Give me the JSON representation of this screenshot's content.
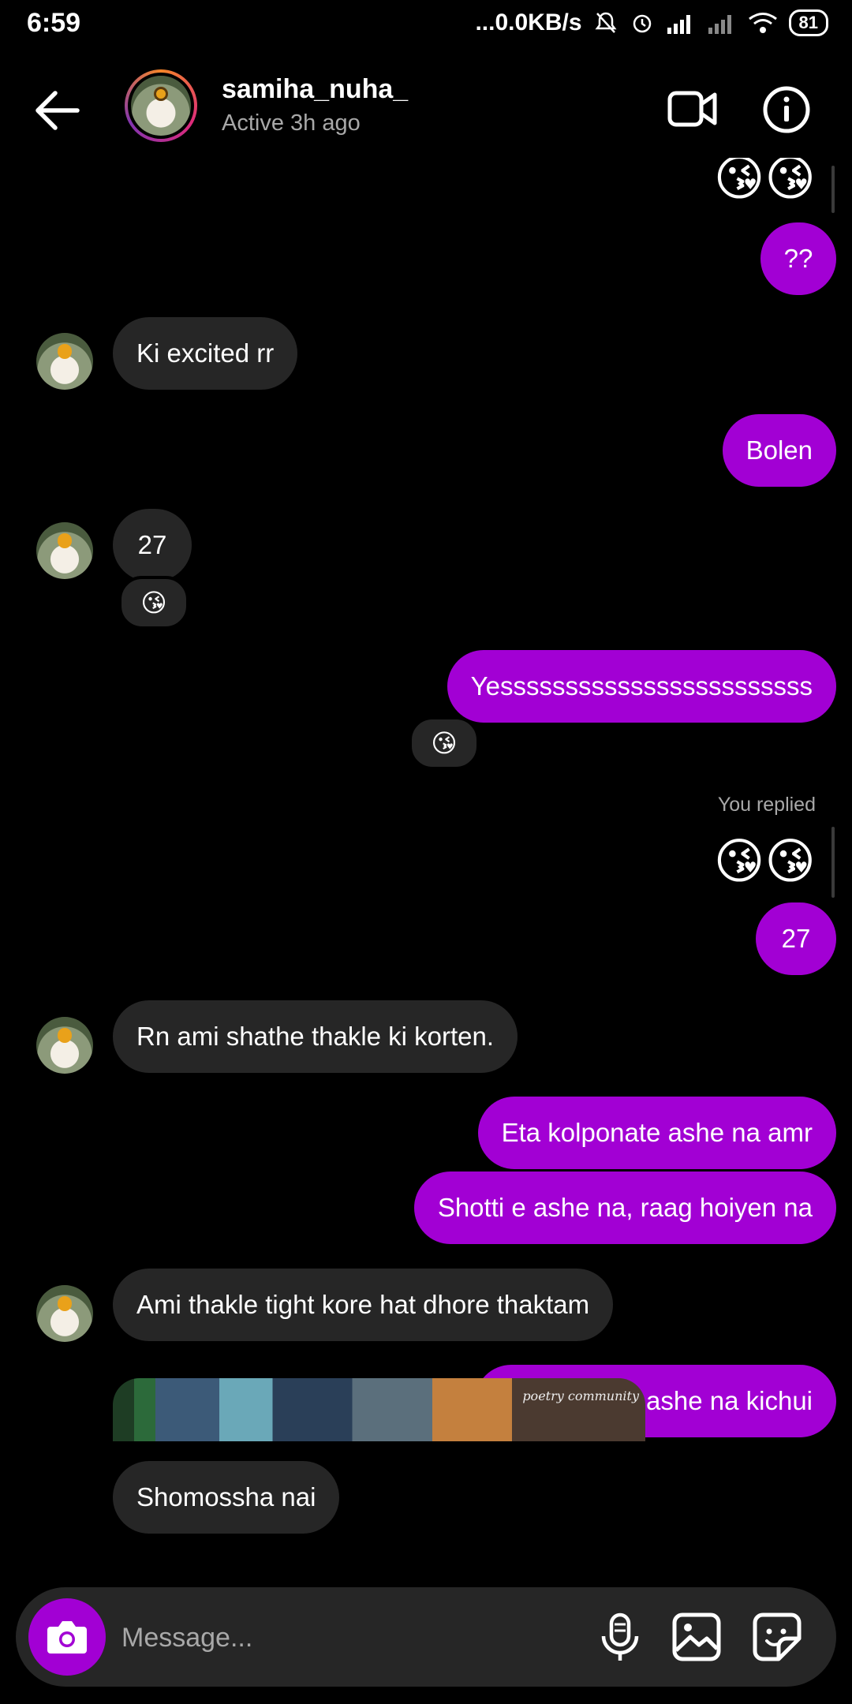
{
  "status_bar": {
    "time": "6:59",
    "network_speed": "...0.0KB/s",
    "battery": "81",
    "icons": [
      "mute-icon",
      "alarm-icon",
      "signal-icon",
      "signal-icon",
      "wifi-icon",
      "battery-icon"
    ]
  },
  "header": {
    "username": "samiha_nuha_",
    "active_status": "Active 3h ago",
    "icons": [
      "back-arrow-icon",
      "video-call-icon",
      "info-icon"
    ]
  },
  "messages": [
    {
      "side": "sent",
      "type": "emoji",
      "text": "😘😘"
    },
    {
      "side": "sent",
      "type": "text",
      "text": "??"
    },
    {
      "side": "received",
      "type": "text",
      "text": "Ki excited rr"
    },
    {
      "side": "sent",
      "type": "text",
      "text": "Bolen"
    },
    {
      "side": "received",
      "type": "text",
      "text": "27",
      "reaction": "😘"
    },
    {
      "side": "sent",
      "type": "text",
      "text": "Yessssssssssssssssssssssss",
      "reaction": "😘"
    },
    {
      "side": "sent",
      "type": "emoji",
      "text": "😘😘",
      "reply_label": "You replied"
    },
    {
      "side": "sent",
      "type": "text",
      "text": "27"
    },
    {
      "side": "received",
      "type": "text",
      "text": "Rn ami shathe thakle ki korten."
    },
    {
      "side": "sent",
      "type": "text",
      "text": "Eta kolponate ashe na amr"
    },
    {
      "side": "sent",
      "type": "text",
      "text": "Shotti e ashe na, raag hoiyen na"
    },
    {
      "side": "received",
      "type": "text",
      "text": "Ami thakle tight kore hat dhore thaktam"
    },
    {
      "side": "sent",
      "type": "text",
      "text": "Amr mathay ashe na kichui"
    },
    {
      "side": "received",
      "type": "text",
      "text": "Shomossha nai"
    },
    {
      "side": "received",
      "type": "image",
      "caption": "poetry community"
    }
  ],
  "composer": {
    "placeholder": "Message...",
    "icons": [
      "camera-icon",
      "microphone-icon",
      "gallery-icon",
      "sticker-icon"
    ]
  },
  "colors": {
    "background": "#000000",
    "sent_bubble": "#a200d4",
    "received_bubble": "#262626",
    "secondary_text": "#a8a8a8"
  }
}
